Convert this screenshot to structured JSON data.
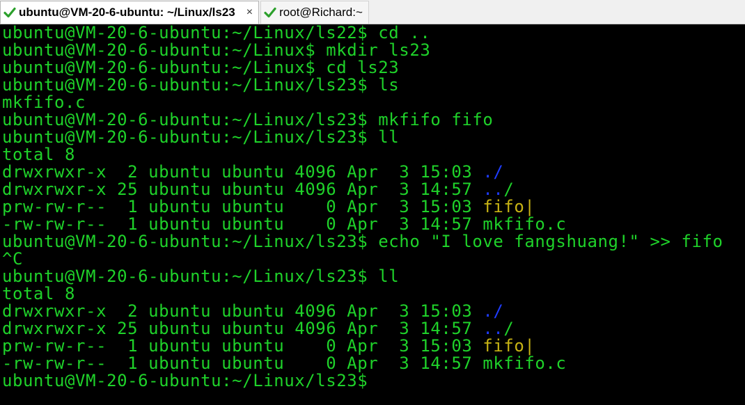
{
  "tabs": [
    {
      "label": "ubuntu@VM-20-6-ubuntu: ~/Linux/ls23",
      "close": "×",
      "status_icon": "green-check-icon"
    },
    {
      "label": "root@Richard:~",
      "status_icon": "green-check-icon"
    }
  ],
  "colors": {
    "background": "#000000",
    "text": "#1fd22a",
    "directory": "#1e3cff",
    "fifo": "#c8b414",
    "check": "#2ca02c"
  },
  "terminal": {
    "lines": [
      {
        "text": "ubuntu@VM-20-6-ubuntu:~/Linux/ls22$ cd .."
      },
      {
        "text": "ubuntu@VM-20-6-ubuntu:~/Linux$ mkdir ls23"
      },
      {
        "text": "ubuntu@VM-20-6-ubuntu:~/Linux$ cd ls23"
      },
      {
        "text": "ubuntu@VM-20-6-ubuntu:~/Linux/ls23$ ls"
      },
      {
        "text": "mkfifo.c"
      },
      {
        "text": "ubuntu@VM-20-6-ubuntu:~/Linux/ls23$ mkfifo fifo"
      },
      {
        "text": "ubuntu@VM-20-6-ubuntu:~/Linux/ls23$ ll"
      },
      {
        "text": "total 8"
      },
      {
        "text": "drwxrwxr-x  2 ubuntu ubuntu 4096 Apr  3 15:03 ",
        "name": "./",
        "name_color": "directory"
      },
      {
        "text": "drwxrwxr-x 25 ubuntu ubuntu 4096 Apr  3 14:57 ",
        "name": "..",
        "name_color": "directory",
        "suffix": "/"
      },
      {
        "text": "prw-rw-r--  1 ubuntu ubuntu    0 Apr  3 15:03 ",
        "name": "fifo|",
        "name_color": "fifo"
      },
      {
        "text": "-rw-rw-r--  1 ubuntu ubuntu    0 Apr  3 14:57 mkfifo.c"
      },
      {
        "text": "ubuntu@VM-20-6-ubuntu:~/Linux/ls23$ echo \"I love fangshuang!\" >> fifo"
      },
      {
        "text": "^C"
      },
      {
        "text": "ubuntu@VM-20-6-ubuntu:~/Linux/ls23$ ll"
      },
      {
        "text": "total 8"
      },
      {
        "text": "drwxrwxr-x  2 ubuntu ubuntu 4096 Apr  3 15:03 ",
        "name": "./",
        "name_color": "directory"
      },
      {
        "text": "drwxrwxr-x 25 ubuntu ubuntu 4096 Apr  3 14:57 ",
        "name": "..",
        "name_color": "directory",
        "suffix": "/"
      },
      {
        "text": "prw-rw-r--  1 ubuntu ubuntu    0 Apr  3 15:03 ",
        "name": "fifo|",
        "name_color": "fifo"
      },
      {
        "text": "-rw-rw-r--  1 ubuntu ubuntu    0 Apr  3 14:57 mkfifo.c"
      },
      {
        "text": "ubuntu@VM-20-6-ubuntu:~/Linux/ls23$"
      }
    ]
  }
}
